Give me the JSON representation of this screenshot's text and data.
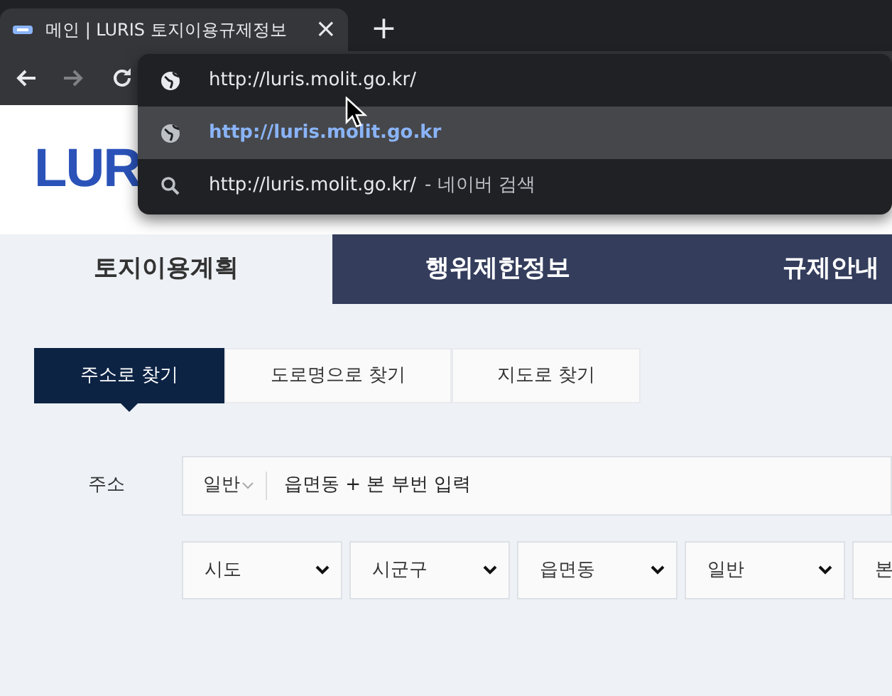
{
  "browser": {
    "tab": {
      "title": "메인 | LURIS 토지이용규제정보",
      "close": "×",
      "selected": true
    },
    "new_tab": "+",
    "nav": [
      {
        "kind": "back",
        "disabled": false
      },
      {
        "kind": "forward",
        "disabled": true
      },
      {
        "kind": "reload",
        "disabled": false
      }
    ],
    "omnibox": {
      "value": "http://luris.molit.go.kr/"
    },
    "suggestions": [
      {
        "kind": "url",
        "text": "http://luris.molit.go.kr",
        "selected": true
      },
      {
        "kind": "search",
        "text": "http://luris.molit.go.kr/",
        "suffix": "- 네이버 검색",
        "selected": false
      }
    ]
  },
  "page": {
    "logo": "LUR",
    "main_tabs": [
      {
        "label": "토지이용계획",
        "selected": true
      },
      {
        "label": "행위제한정보",
        "selected": false
      },
      {
        "label": "규제안내",
        "selected": false
      }
    ],
    "search_tabs": [
      {
        "label": "주소로 찾기",
        "selected": true
      },
      {
        "label": "도로명으로 찾기",
        "selected": false
      },
      {
        "label": "지도로 찾기",
        "selected": false
      }
    ],
    "address": {
      "label": "주소",
      "type": "일반",
      "placeholder": "읍면동 + 본 부번 입력"
    },
    "selects": [
      "시도",
      "시군구",
      "읍면동",
      "일반",
      "본"
    ]
  }
}
